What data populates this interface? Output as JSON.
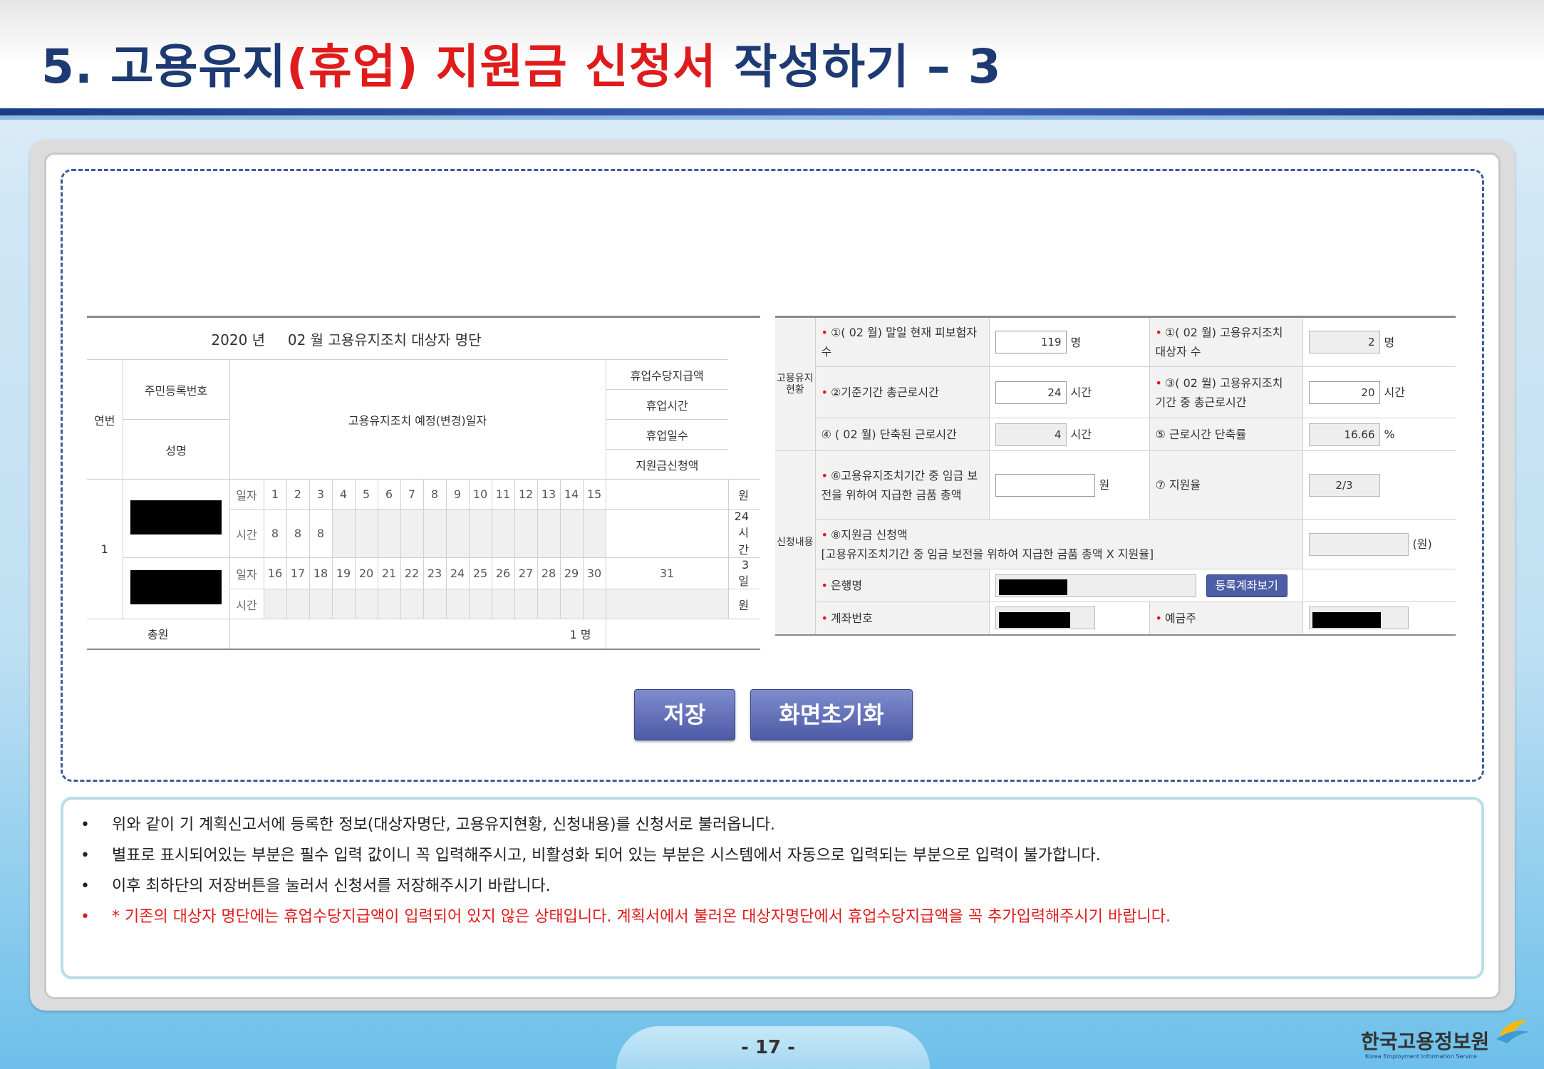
{
  "header": {
    "title_part1": "5. 고용유지",
    "title_part2": "(휴업) 지원금 신청서",
    "title_part3": " 작성하기 – 3"
  },
  "left_table": {
    "title_year": "2020 년",
    "title_rest": "02 월 고용유지조치 대상자 명단",
    "col_serial": "연번",
    "col_resident_number": "주민등록번호",
    "col_name": "성명",
    "col_schedule": "고용유지조치 예정(변경)일자",
    "col_allowance": "휴업수당지급액",
    "col_hours": "휴업시간",
    "col_days": "휴업일수",
    "col_request": "지원금신청액",
    "row_serial": "1",
    "label_day": "일자",
    "label_time": "시간",
    "days_1": [
      "1",
      "2",
      "3",
      "4",
      "5",
      "6",
      "7",
      "8",
      "9",
      "10",
      "11",
      "12",
      "13",
      "14",
      "15",
      ""
    ],
    "hours_1": [
      "8",
      "8",
      "8",
      "",
      "",
      "",
      "",
      "",
      "",
      "",
      "",
      "",
      "",
      "",
      "",
      ""
    ],
    "days_2": [
      "16",
      "17",
      "18",
      "19",
      "20",
      "21",
      "22",
      "23",
      "24",
      "25",
      "26",
      "27",
      "28",
      "29",
      "30",
      "31"
    ],
    "hours_2": [
      "",
      "",
      "",
      "",
      "",
      "",
      "",
      "",
      "",
      "",
      "",
      "",
      "",
      "",
      "",
      ""
    ],
    "val_allowance": "원",
    "val_hours": "24 시간",
    "val_days": "3 일",
    "val_request": "원",
    "total_label": "총원",
    "total_value": "1 명"
  },
  "right_table": {
    "cat_status": "고용유지현황",
    "cat_request": "신청내용",
    "r1_label": "①( 02 월) 말일 현재 피보험자수",
    "r1_value": "119",
    "r1_unit": "명",
    "r1b_label": "①( 02 월) 고용유지조치 대상자 수",
    "r1b_value": "2",
    "r1b_unit": "명",
    "r2_label": "②기준기간 총근로시간",
    "r2_value": "24",
    "r2_unit": "시간",
    "r2b_label": "③( 02 월) 고용유지조치 기간 중 총근로시간",
    "r2b_value": "20",
    "r2b_unit": "시간",
    "r3_label": "④ ( 02 월) 단축된 근로시간",
    "r3_value": "4",
    "r3_unit": "시간",
    "r3b_label": "⑤ 근로시간 단축률",
    "r3b_value": "16.66",
    "r3b_unit": "%",
    "r4_label": "⑥고용유지조치기간 중 임금 보전을 위하여 지급한 금품 총액",
    "r4_value": "",
    "r4_unit": "원",
    "r4b_label": "⑦ 지원율",
    "r4b_value": "2/3",
    "r5_label": "⑧지원금 신청액",
    "r5_sub": "[고용유지조치기간 중 임금 보전을 위하여 지급한 금품 총액 X 지원율]",
    "r5_value": "",
    "r5_unit": "(원)",
    "r6_label": "은행명",
    "r6_button": "등록계좌보기",
    "r7_label": "계좌번호",
    "r7b_label": "예금주"
  },
  "buttons": {
    "save": "저장",
    "reset": "화면초기화"
  },
  "notes": [
    "위와 같이 기 계획신고서에 등록한 정보(대상자명단, 고용유지현황, 신청내용)를 신청서로 불러옵니다.",
    "별표로 표시되어있는 부분은 필수 입력 값이니 꼭 입력해주시고, 비활성화 되어 있는 부분은 시스템에서 자동으로 입력되는 부분으로 입력이 불가합니다.",
    "이후 최하단의 저장버튼을 눌러서 신청서를 저장해주시기 바랍니다.",
    "* 기존의 대상자 명단에는 휴업수당지급액이 입력되어 있지 않은 상태입니다. 계획서에서 불러온 대상자명단에서 휴업수당지급액을 꼭 추가입력해주시기 바랍니다."
  ],
  "footer": {
    "page": "- 17 -",
    "logo_text": "한국고용정보원",
    "logo_sub": "Korea Employment Information Service"
  },
  "colors": {
    "title_blue": "#1d3a72",
    "title_red": "#e01b1b",
    "button_blue": "#4d5ea6"
  }
}
